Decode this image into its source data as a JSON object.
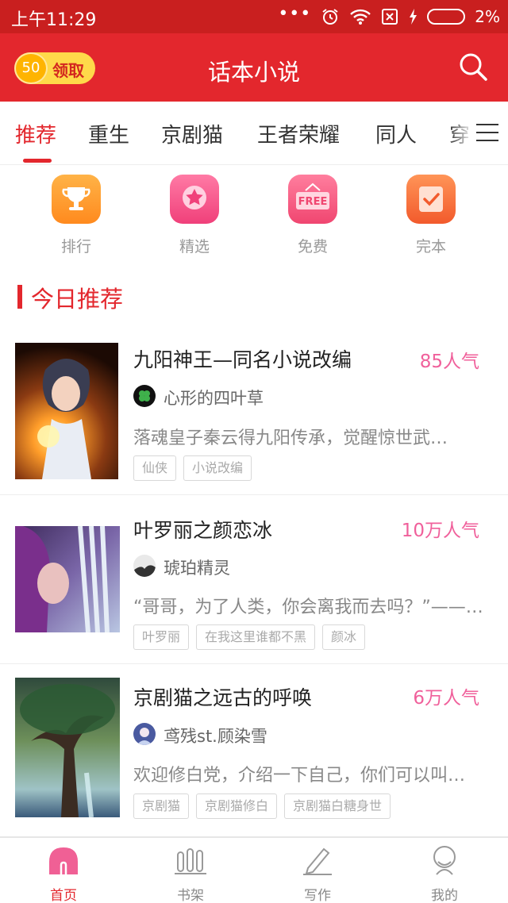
{
  "status_bar": {
    "time": "上午11:29",
    "battery": "2%",
    "dots": "•••"
  },
  "header": {
    "title": "话本小说",
    "coins": "50",
    "claim_label": "领取"
  },
  "tabs": [
    "推荐",
    "重生",
    "京剧猫",
    "王者荣耀",
    "同人",
    "穿"
  ],
  "quick_entries": [
    {
      "label": "排行",
      "icon": "trophy-icon"
    },
    {
      "label": "精选",
      "icon": "star-icon"
    },
    {
      "label": "免费",
      "icon": "free-icon",
      "badge": "FREE"
    },
    {
      "label": "完本",
      "icon": "check-icon"
    }
  ],
  "section": {
    "title": "今日推荐"
  },
  "books": [
    {
      "title": "九阳神王—同名小说改编",
      "popularity": "85人气",
      "author": "心形的四叶草",
      "description": "落魂皇子秦云得九阳传承，觉醒惊世武…",
      "tags": [
        "仙侠",
        "小说改编"
      ]
    },
    {
      "title": "叶罗丽之颜恋冰",
      "popularity": "10万人气",
      "author": "琥珀精灵",
      "description": "“哥哥，为了人类，你会离我而去吗？”——…",
      "tags": [
        "叶罗丽",
        "在我这里谁都不黑",
        "颜冰"
      ]
    },
    {
      "title": "京剧猫之远古的呼唤",
      "popularity": "6万人气",
      "author": "鸢残st.顾染雪",
      "description": "欢迎修白党，介绍一下自己，你们可以叫…",
      "tags": [
        "京剧猫",
        "京剧猫修白",
        "京剧猫白糖身世"
      ]
    }
  ],
  "bottom_nav": [
    {
      "label": "首页",
      "icon": "home-icon",
      "active": true
    },
    {
      "label": "书架",
      "icon": "bookshelf-icon",
      "active": false
    },
    {
      "label": "写作",
      "icon": "pen-icon",
      "active": false
    },
    {
      "label": "我的",
      "icon": "profile-icon",
      "active": false
    }
  ],
  "colors": {
    "brand_red": "#e3272d",
    "status_red": "#c91f1f",
    "popularity_pink": "#f0609b",
    "coin_yellow": "#ffd94a"
  }
}
